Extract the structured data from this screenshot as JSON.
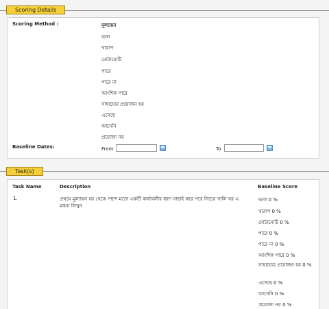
{
  "scoring": {
    "section_title": "Scoring Details",
    "method_label": "Scoring Method :",
    "method_value": "মূল্যায়ন",
    "options": [
      "ভাল",
      "খারাপ",
      "মোটামোটি",
      "পারে",
      "পারে না",
      "আংশিক পারে",
      "সাহায্যের প্রয়োজন হয়",
      "এসেছে",
      "আসেনি",
      "প্রযোজ্য নয়"
    ],
    "baseline_label": "Baseline Dates:",
    "from_label": "From",
    "to_label": "To",
    "from_value": "",
    "to_value": ""
  },
  "tasks": {
    "section_title": "Task(s)",
    "col_name": "Task Name",
    "col_desc": "Description",
    "col_score": "Baseline Score",
    "rows": [
      {
        "name": "1.",
        "description": "প্রথমে মূল্যায়ন হয় থেকে পছন্দ মতো একটি কার্যাবলীর ধরণ বাছাই করে পরে নিচের খালি ঘর এ মন্তব্য লিখুন",
        "scores": [
          "ভাল 0 %",
          "খারাপ 0 %",
          "মোটামোটি 0 %",
          "পারে 0 %",
          "পারে না 0 %",
          "আংশিক পারে 0 %",
          "সাহায্যের প্রয়োজন হয় 0 %",
          "এসেছে 0 %",
          "আসেনি 0 %",
          "প্রযোজ্য নয় 0 %"
        ]
      }
    ]
  }
}
